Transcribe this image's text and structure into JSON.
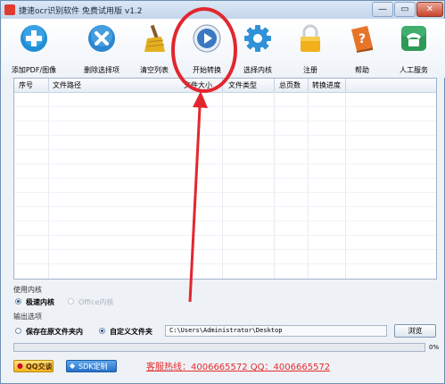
{
  "window": {
    "title": "捷速ocr识别软件 免费试用版 v1.2",
    "controls": {
      "minimize": "—",
      "maximize": "▭",
      "close": "✕"
    }
  },
  "toolbar": {
    "items": [
      {
        "label": "添加PDF/图像",
        "icon": "plus-icon",
        "color": "#1f8fd6"
      },
      {
        "label": "删除选择项",
        "icon": "delete-icon",
        "color": "#2c86d1"
      },
      {
        "label": "清空列表",
        "icon": "broom-icon",
        "color": "#e4b020"
      },
      {
        "label": "开始转换",
        "icon": "play-icon",
        "color": "#3b78c2"
      },
      {
        "label": "选择内核",
        "icon": "gear-icon",
        "color": "#2f92d8"
      },
      {
        "label": "注册",
        "icon": "lock-icon",
        "color": "#f2b01a"
      },
      {
        "label": "帮助",
        "icon": "help-book-icon",
        "color": "#e8742a"
      },
      {
        "label": "人工服务",
        "icon": "phone-icon",
        "color": "#2e9a5a"
      }
    ]
  },
  "table": {
    "columns": [
      "序号",
      "文件路径",
      "文件大小",
      "文件类型",
      "总页数",
      "转换进度"
    ],
    "rows": []
  },
  "engine": {
    "section_label": "使用内核",
    "options": [
      {
        "label": "极速内核",
        "selected": true,
        "enabled": true
      },
      {
        "label": "Office内核",
        "selected": false,
        "enabled": false
      }
    ]
  },
  "output": {
    "section_label": "输出选项",
    "options": [
      {
        "label": "保存在原文件夹内",
        "selected": false
      },
      {
        "label": "自定义文件夹",
        "selected": true
      }
    ],
    "path": "C:\\Users\\Administrator\\Desktop",
    "browse_label": "浏览"
  },
  "progress": {
    "value": 0,
    "label": "0%"
  },
  "footer": {
    "qq_label": "QQ交谈",
    "sdk_label": "SDK定制",
    "hotline": "客服热线：4006665572 QQ：4006665572"
  },
  "colors": {
    "annotation": "#e3262e",
    "accent": "#3b78c2"
  }
}
